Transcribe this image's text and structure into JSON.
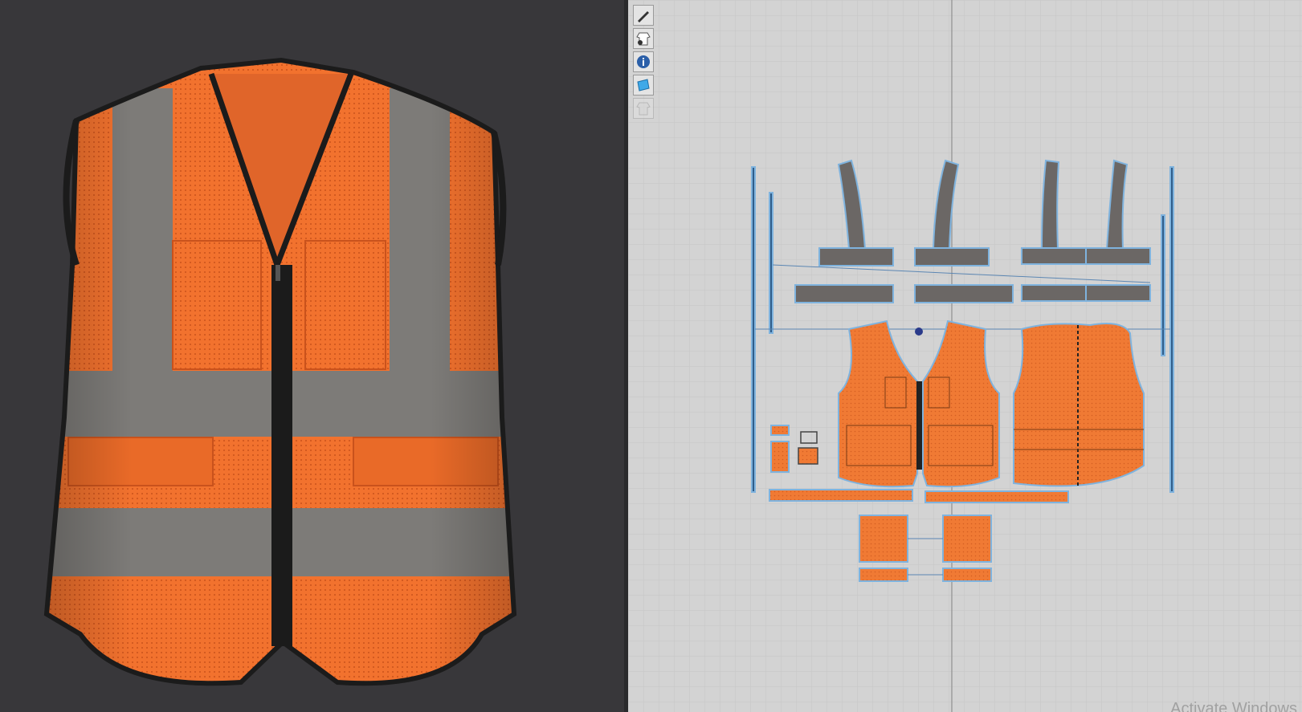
{
  "colors": {
    "viewport_bg": "#38373a",
    "pattern_bg": "#d3d3d3",
    "vest_orange": "#f2722e",
    "reflective_grey": "#7d7b78",
    "binding_black": "#1b1b1b",
    "piece_outline": "#6aa6d8"
  },
  "toolbar": {
    "tools": [
      {
        "name": "pen-tool",
        "icon": "pen-icon"
      },
      {
        "name": "show-garment",
        "icon": "garment-eye-icon"
      },
      {
        "name": "info",
        "icon": "info-icon"
      },
      {
        "name": "texture",
        "icon": "texture-icon"
      },
      {
        "name": "show-avatar",
        "icon": "avatar-icon",
        "disabled": true
      }
    ]
  },
  "watermark": {
    "text": "Activate Windows"
  }
}
